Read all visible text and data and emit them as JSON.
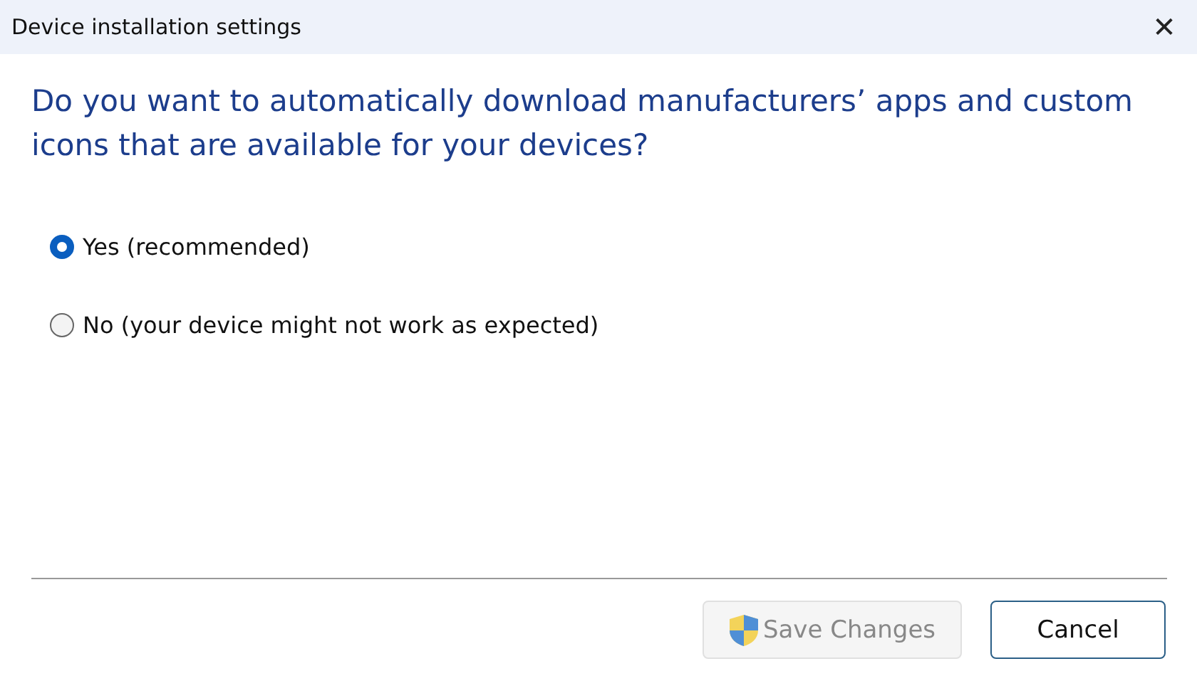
{
  "window": {
    "title": "Device installation settings",
    "close": "✕"
  },
  "question": "Do you want to automatically download manufacturers’ apps and custom icons that are available for your devices?",
  "options": [
    {
      "label": "Yes (recommended)",
      "selected": true
    },
    {
      "label": "No (your device might not work as expected)",
      "selected": false
    }
  ],
  "buttons": [
    {
      "label": "Save Changes",
      "kind": "shield",
      "disabled": true
    },
    {
      "label": "Cancel",
      "kind": "plain",
      "disabled": false
    }
  ]
}
